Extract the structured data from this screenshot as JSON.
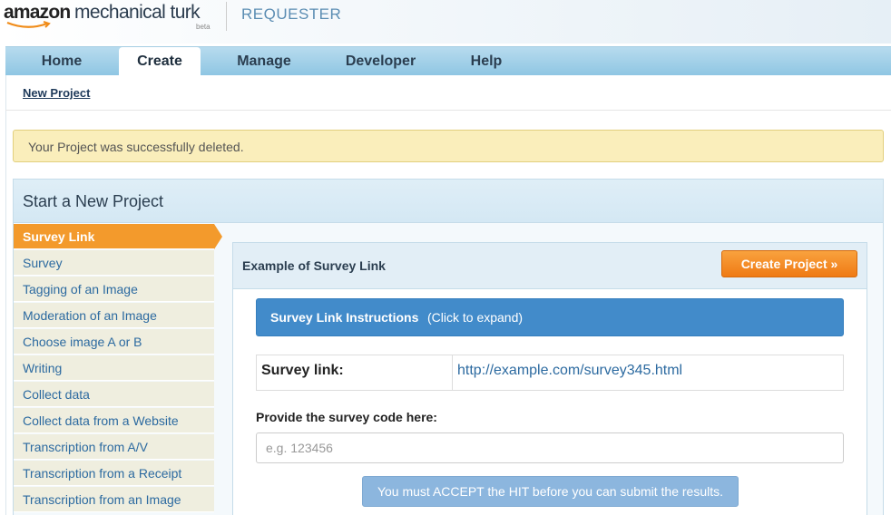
{
  "brand": {
    "amazon": "amazon",
    "product": "mechanical turk",
    "badge": "beta",
    "section": "REQUESTER"
  },
  "nav": {
    "tabs": [
      {
        "label": "Home",
        "active": false
      },
      {
        "label": "Create",
        "active": true
      },
      {
        "label": "Manage",
        "active": false
      },
      {
        "label": "Developer",
        "active": false
      },
      {
        "label": "Help",
        "active": false
      }
    ]
  },
  "breadcrumb": "New Project",
  "alert": "Your Project was successfully deleted.",
  "panel": {
    "title": "Start a New Project",
    "sidebar": [
      {
        "label": "Survey Link",
        "active": true
      },
      {
        "label": "Survey",
        "active": false
      },
      {
        "label": "Tagging of an Image",
        "active": false
      },
      {
        "label": "Moderation of an Image",
        "active": false
      },
      {
        "label": "Choose image A or B",
        "active": false
      },
      {
        "label": "Writing",
        "active": false
      },
      {
        "label": "Collect data",
        "active": false
      },
      {
        "label": "Collect data from a Website",
        "active": false
      },
      {
        "label": "Transcription from A/V",
        "active": false
      },
      {
        "label": "Transcription from a Receipt",
        "active": false
      },
      {
        "label": "Transcription from an Image",
        "active": false
      }
    ],
    "example": {
      "title": "Example of Survey Link",
      "create_button": "Create Project »",
      "instructions_title": "Survey Link Instructions",
      "instructions_hint": "(Click to expand)",
      "survey_link_label": "Survey link:",
      "survey_link_value": "http://example.com/survey345.html",
      "code_label": "Provide the survey code here:",
      "code_placeholder": "e.g. 123456",
      "accept_notice": "You must ACCEPT the HIT before you can submit the results."
    }
  },
  "colors": {
    "nav_blue": "#8fc6e3",
    "accent_orange": "#f39a2c",
    "instructions_blue": "#428bca",
    "alert_yellow": "#faeebb"
  }
}
